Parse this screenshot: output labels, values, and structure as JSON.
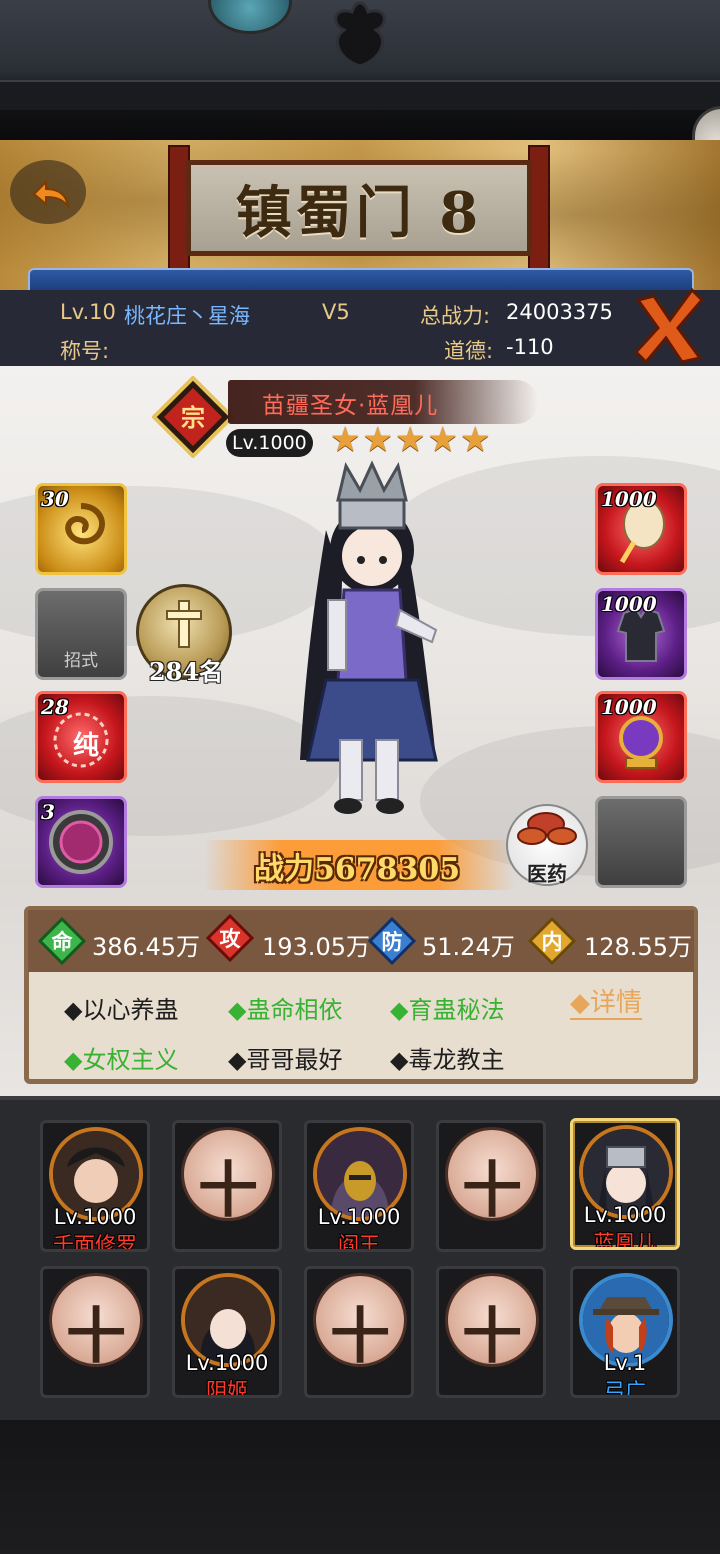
{
  "location_sign": "镇蜀门 8",
  "player": {
    "level_label": "Lv.10",
    "server": "桃花庄丶星海",
    "vip": "V5",
    "total_power_label": "总战力:",
    "total_power_value": "24003375",
    "title_label": "称号:",
    "morality_label": "道德:",
    "morality_value": "-110"
  },
  "hero": {
    "name": "苗疆圣女·蓝凰儿",
    "level": "Lv.1000",
    "stars": 5,
    "rank": "284名",
    "power": "战力5678305",
    "medicine_label": "医药",
    "empty_slot_label": "招式"
  },
  "equipment": {
    "left": [
      {
        "count": "30",
        "type": "gold"
      },
      {
        "count": "",
        "type": "empty"
      },
      {
        "count": "28",
        "type": "red"
      },
      {
        "count": "3",
        "type": "purple"
      }
    ],
    "right": [
      {
        "count": "1000",
        "type": "red"
      },
      {
        "count": "1000",
        "type": "purple"
      },
      {
        "count": "1000",
        "type": "red"
      },
      {
        "count": "",
        "type": "empty"
      }
    ]
  },
  "stats": [
    {
      "icon": "命",
      "value": "386.45万",
      "color": "#3cb54a"
    },
    {
      "icon": "攻",
      "value": "193.05万",
      "color": "#d9342b"
    },
    {
      "icon": "防",
      "value": "51.24万",
      "color": "#3a7fd0"
    },
    {
      "icon": "内",
      "value": "128.55万",
      "color": "#e3a72f"
    }
  ],
  "traits": [
    {
      "text": "◆以心养蛊",
      "active": false
    },
    {
      "text": "◆蛊命相依",
      "active": true
    },
    {
      "text": "◆育蛊秘法",
      "active": true
    },
    {
      "text": "◆女权主义",
      "active": true
    },
    {
      "text": "◆哥哥最好",
      "active": false
    },
    {
      "text": "◆毒龙教主",
      "active": false
    }
  ],
  "detail_link": "◆详情",
  "team": [
    {
      "lv": "Lv.1000",
      "name": "千面修罗",
      "empty": false
    },
    {
      "lv": "",
      "name": "",
      "empty": true,
      "plus": "十"
    },
    {
      "lv": "Lv.1000",
      "name": "阎王",
      "empty": false
    },
    {
      "lv": "",
      "name": "",
      "empty": true,
      "plus": "十"
    },
    {
      "lv": "Lv.1000",
      "name": "蓝凰儿",
      "empty": false,
      "selected": true
    },
    {
      "lv": "",
      "name": "",
      "empty": true,
      "plus": "十"
    },
    {
      "lv": "Lv.1000",
      "name": "阴姬",
      "empty": false
    },
    {
      "lv": "",
      "name": "",
      "empty": true,
      "plus": "十"
    },
    {
      "lv": "",
      "name": "",
      "empty": true,
      "plus": "十"
    },
    {
      "lv": "Lv.1",
      "name": "弓广",
      "empty": false,
      "name_color": "blue"
    }
  ]
}
